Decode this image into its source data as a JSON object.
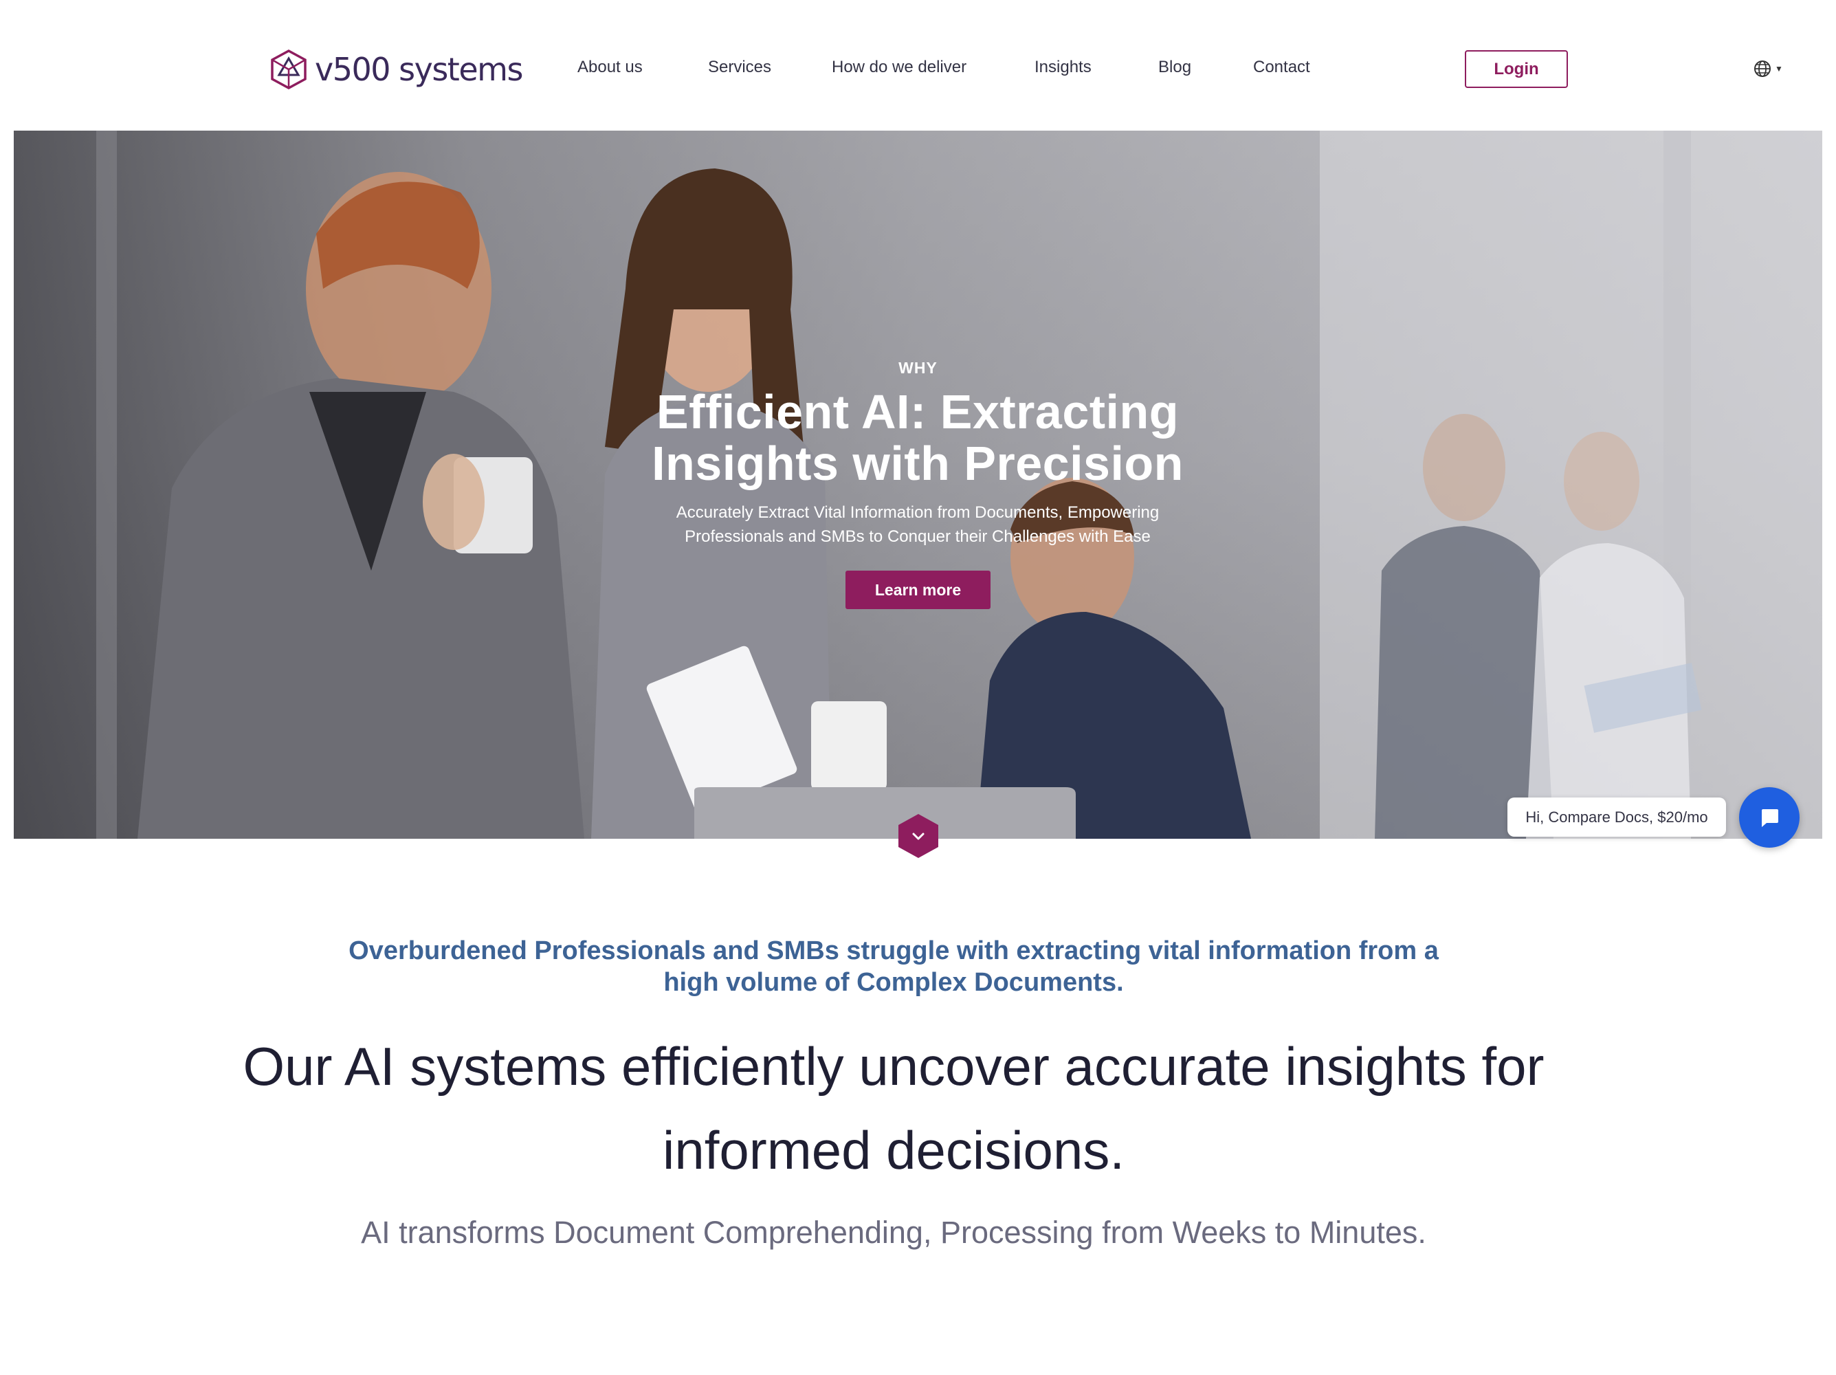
{
  "brand": {
    "name": "v500 systems",
    "accent": "#8e1d5e",
    "navy": "#3a2a5a"
  },
  "nav": {
    "items": [
      {
        "label": "About us"
      },
      {
        "label": "Services"
      },
      {
        "label": "How do we deliver"
      },
      {
        "label": "Insights"
      },
      {
        "label": "Blog"
      },
      {
        "label": "Contact"
      }
    ],
    "login_label": "Login",
    "language_icon": "globe-icon"
  },
  "hero": {
    "eyebrow": "WHY",
    "title": "Efficient AI: Extracting Insights with Precision",
    "subtitle": "Accurately Extract Vital Information from Documents, Empowering Professionals and SMBs to Conquer their Challenges with Ease",
    "cta_label": "Learn more",
    "scroll_icon": "chevron-down-icon"
  },
  "chat": {
    "bubble_text": "Hi, Compare Docs, $20/mo",
    "button_icon": "chat-icon",
    "button_color": "#1f5fe0"
  },
  "intro": {
    "lead": "Overburdened Professionals and SMBs struggle with extracting vital information from a high volume of Complex Documents.",
    "headline": "Our AI systems efficiently uncover accurate insights for informed decisions.",
    "subline": "AI transforms Document Comprehending, Processing from Weeks to Minutes."
  }
}
